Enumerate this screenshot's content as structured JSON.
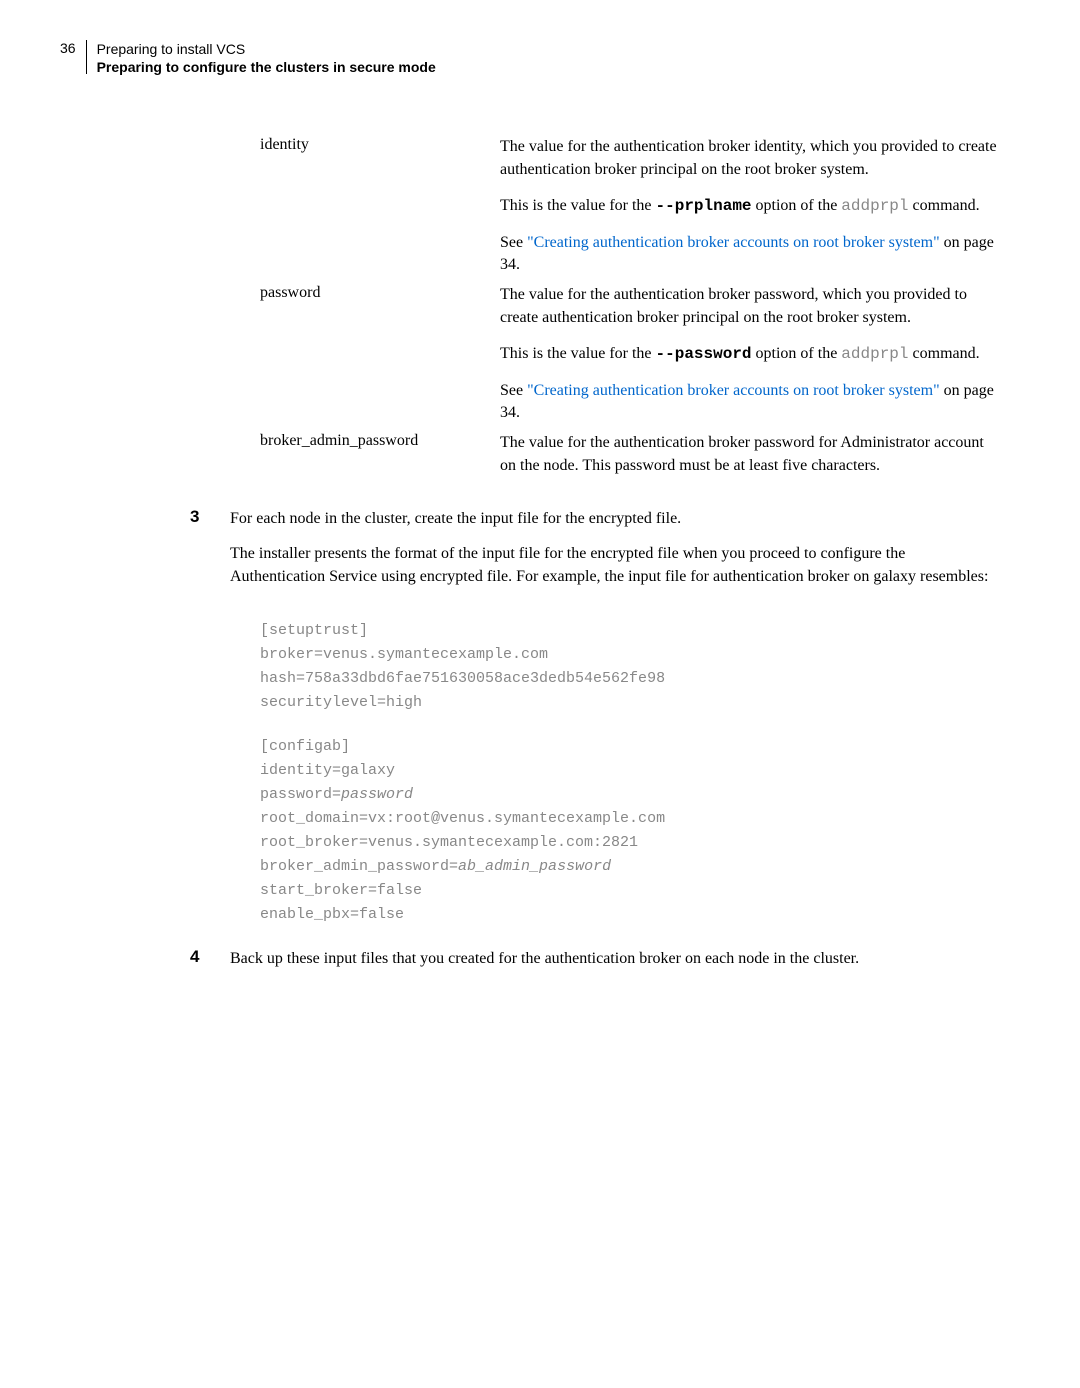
{
  "header": {
    "pagenum": "36",
    "title": "Preparing to install VCS",
    "subtitle": "Preparing to configure the clusters in secure mode"
  },
  "defs": {
    "identity": {
      "term": "identity",
      "p1a": "The value for the authentication broker identity, which you provided to create authentication broker principal on the root broker system.",
      "p2a": "This is the value for the ",
      "p2b": "--prplname",
      "p2c": " option of the ",
      "p2d": "addprpl",
      "p2e": " command.",
      "p3a": "See ",
      "p3b": "\"Creating authentication broker accounts on root broker system\"",
      "p3c": " on page 34."
    },
    "password": {
      "term": "password",
      "p1a": "The value for the authentication broker password, which you provided to create authentication broker principal on the root broker system.",
      "p2a": "This is the value for the ",
      "p2b": "--password",
      "p2c": " option of the ",
      "p2d": "addprpl",
      "p2e": " command.",
      "p3a": "See ",
      "p3b": "\"Creating authentication broker accounts on root broker system\"",
      "p3c": " on page 34."
    },
    "broker_admin": {
      "term": "broker_admin_password",
      "p1": "The value for the authentication broker password for Administrator account on the node. This password must be at least five characters."
    }
  },
  "steps": {
    "s3": {
      "num": "3",
      "p1": "For each node in the cluster, create the input file for the encrypted file.",
      "p2": "The installer presents the format of the input file for the encrypted file when you proceed to configure the Authentication Service using encrypted file. For example, the input file for authentication broker on galaxy resembles:"
    },
    "s4": {
      "num": "4",
      "p1": "Back up these input files that you created for the authentication broker on each node in the cluster."
    }
  },
  "code": {
    "l1": "[setuptrust]",
    "l2": "broker=venus.symantecexample.com",
    "l3": "hash=758a33dbd6fae751630058ace3dedb54e562fe98",
    "l4": "securitylevel=high",
    "l5": "[configab]",
    "l6": "identity=galaxy",
    "l7a": "password=",
    "l7b": "password",
    "l8": "root_domain=vx:root@venus.symantecexample.com",
    "l9": "root_broker=venus.symantecexample.com:2821",
    "l10a": "broker_admin_password=",
    "l10b": "ab_admin_password",
    "l11": "start_broker=false",
    "l12": "enable_pbx=false"
  }
}
